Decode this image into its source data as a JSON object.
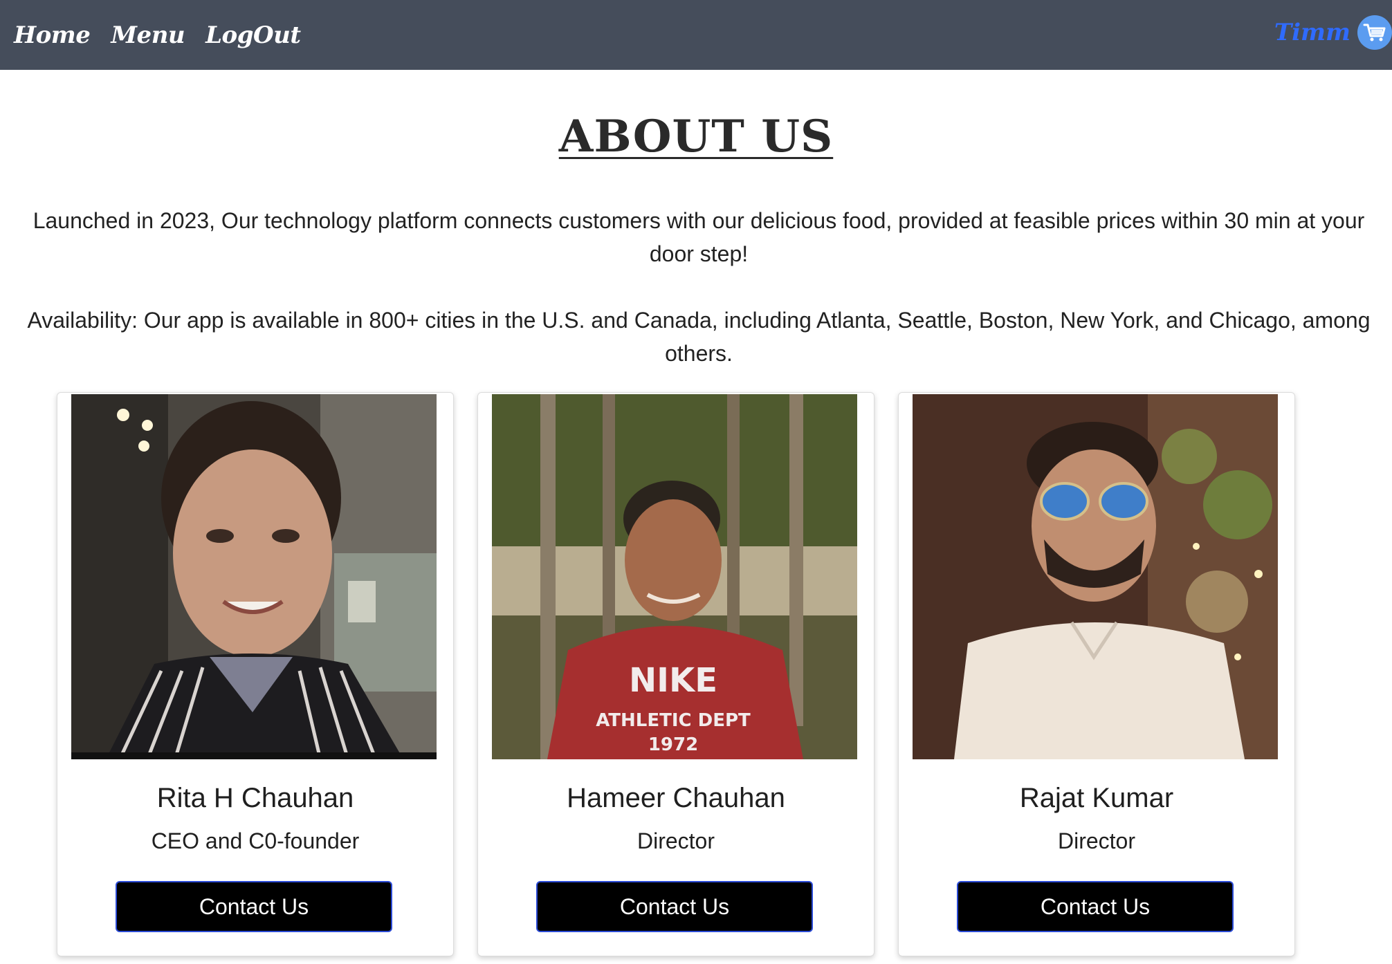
{
  "nav": {
    "home": "Home",
    "menu": "Menu",
    "logout": "LogOut",
    "brand": "Timm"
  },
  "page": {
    "title": "ABOUT US",
    "intro": "Launched in 2023, Our technology platform connects customers with our delicious food, provided at feasible prices within 30 min at your door step!",
    "availability": "Availability: Our app is available in 800+ cities in the U.S. and Canada, including Atlanta, Seattle, Boston, New York, and Chicago, among others."
  },
  "team": [
    {
      "name": "Rita H Chauhan",
      "role": "CEO and C0-founder",
      "button": "Contact Us"
    },
    {
      "name": "Hameer Chauhan",
      "role": "Director",
      "button": "Contact Us"
    },
    {
      "name": "Rajat Kumar",
      "role": "Director",
      "button": "Contact Us"
    }
  ],
  "colors": {
    "navbar": "#454d5b",
    "brand": "#2f6bff",
    "button": "#000000",
    "button_border": "#2b4bd6"
  },
  "icons": {
    "cart": "shopping-cart-icon"
  }
}
